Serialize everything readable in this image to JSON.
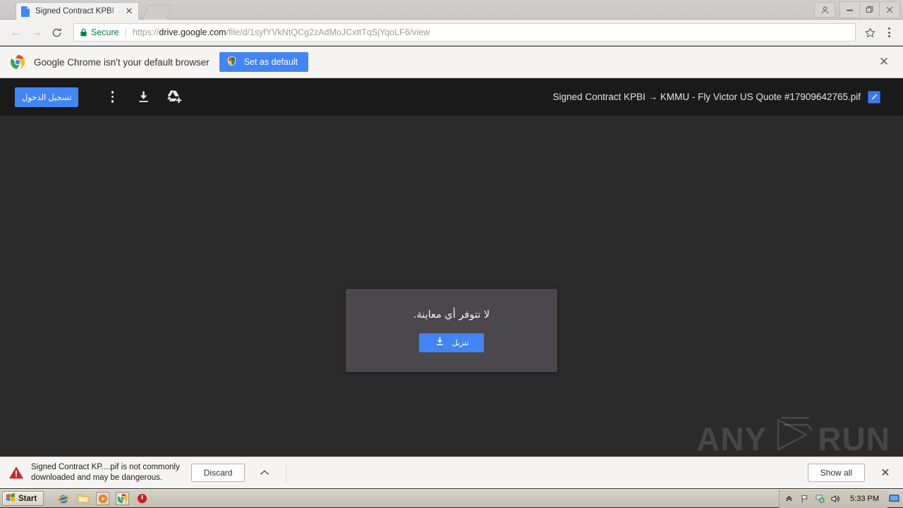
{
  "browser": {
    "tab": {
      "title": "Signed Contract KPBI → KM",
      "favicon_name": "doc-file-icon",
      "close_label": "✕"
    },
    "newtab_label": "",
    "window_controls": {
      "profile": "person-icon",
      "minimize": "—",
      "maximize": "❐",
      "close": "✕"
    },
    "nav": {
      "back": "←",
      "forward": "→",
      "reload": "⟳"
    },
    "omnibox": {
      "security_label": "Secure",
      "scheme": "https://",
      "host": "drive.google.com",
      "path": "/file/d/1syfYVkNtQCg2zAdMoJCxttTqSjYqoLF6/view",
      "full_url": "https://drive.google.com/file/d/1syfYVkNtQCg2zAdMoJCxttTqSjYqoLF6/view",
      "bookmark_icon": "star-icon",
      "menu_icon": "three-dot-menu-icon"
    }
  },
  "infobar": {
    "message": "Google Chrome isn't your default browser",
    "button_label": "Set as default",
    "close_label": "✕",
    "button_color": "#4285f4"
  },
  "drive": {
    "signin_label": "تسجيل الدخول",
    "kebab_icon": "more-options-icon",
    "download_icon": "download-icon",
    "add_to_drive_icon": "add-to-drive-icon",
    "file_title": "Signed Contract KPBI → KMMU - Fly Victor US Quote #17909642765.pif",
    "file_badge_icon": "file-type-badge-icon",
    "toolbar_bg": "#1a1a1a",
    "viewer_bg": "#2b2b2b",
    "preview": {
      "message": "لا تتوفر أي معاينة.",
      "download_label": "تنزيل",
      "card_bg": "#4a474d",
      "button_color": "#4285f4"
    },
    "watermark": {
      "left": "ANY",
      "right": "RUN"
    }
  },
  "download_shelf": {
    "warning_icon": "danger-triangle-icon",
    "message_line1": "Signed Contract  KP....pif is not commonly",
    "message_line2": "downloaded and may be dangerous.",
    "discard_label": "Discard",
    "expand_icon": "chevron-up-icon",
    "show_all_label": "Show all",
    "close_label": "✕"
  },
  "taskbar": {
    "start_label": "Start",
    "quick_launch": [
      "internet-explorer-icon",
      "folder-icon",
      "media-player-icon",
      "chrome-icon",
      "power-icon"
    ],
    "tray_icons": [
      "show-hidden-icons-chevron",
      "flag-icon",
      "network-icon",
      "volume-icon"
    ],
    "clock": "5:33 PM",
    "show_desktop_icon": "show-desktop-icon"
  }
}
